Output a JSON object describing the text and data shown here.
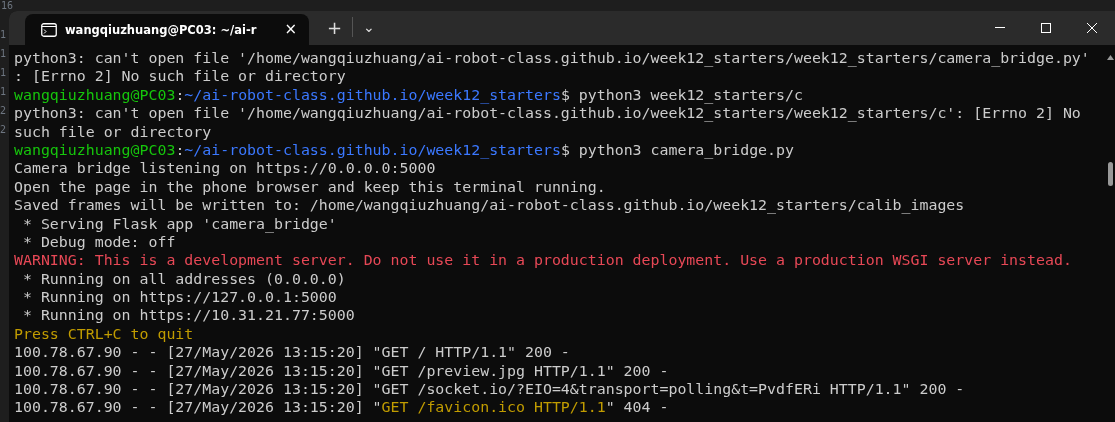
{
  "editor_gutter": {
    "line_numbers": [
      "16",
      "1",
      "1",
      "1",
      "1",
      "2",
      "2"
    ]
  },
  "window": {
    "tab": {
      "title": "wangqiuzhuang@PC03: ~/ai-r",
      "selected": true,
      "close": "×"
    },
    "new_tab": "+",
    "dropdown": "⌄"
  },
  "terminal": {
    "lines": [
      {
        "segments": [
          {
            "text": "python3: can't open file '/home/wangqiuzhuang/ai-robot-class.github.io/week12_starters/week12_starters/camera_bridge.py'",
            "color": "#cccccc"
          }
        ]
      },
      {
        "segments": [
          {
            "text": ": [Errno 2] No such file or directory",
            "color": "#cccccc"
          }
        ]
      },
      {
        "segments": [
          {
            "text": "wangqiuzhuang@PC03",
            "color": "#16c60c"
          },
          {
            "text": ":",
            "color": "#cccccc"
          },
          {
            "text": "~/ai-robot-class.github.io/week12_starters",
            "color": "#3b78ff"
          },
          {
            "text": "$ python3 week12_starters/c",
            "color": "#cccccc"
          }
        ]
      },
      {
        "segments": [
          {
            "text": "python3: can't open file '/home/wangqiuzhuang/ai-robot-class.github.io/week12_starters/week12_starters/c': [Errno 2] No",
            "color": "#cccccc"
          }
        ]
      },
      {
        "segments": [
          {
            "text": "such file or directory",
            "color": "#cccccc"
          }
        ]
      },
      {
        "segments": [
          {
            "text": "wangqiuzhuang@PC03",
            "color": "#16c60c"
          },
          {
            "text": ":",
            "color": "#cccccc"
          },
          {
            "text": "~/ai-robot-class.github.io/week12_starters",
            "color": "#3b78ff"
          },
          {
            "text": "$ python3 camera_bridge.py",
            "color": "#cccccc"
          }
        ]
      },
      {
        "segments": [
          {
            "text": "Camera bridge listening on https://0.0.0.0:5000",
            "color": "#cccccc"
          }
        ]
      },
      {
        "segments": [
          {
            "text": "Open the page in the phone browser and keep this terminal running.",
            "color": "#cccccc"
          }
        ]
      },
      {
        "segments": [
          {
            "text": "Saved frames will be written to: /home/wangqiuzhuang/ai-robot-class.github.io/week12_starters/calib_images",
            "color": "#cccccc"
          }
        ]
      },
      {
        "segments": [
          {
            "text": " * Serving Flask app 'camera_bridge'",
            "color": "#cccccc"
          }
        ]
      },
      {
        "segments": [
          {
            "text": " * Debug mode: off",
            "color": "#cccccc"
          }
        ]
      },
      {
        "segments": [
          {
            "text": "WARNING: This is a development server. Do not use it in a production deployment. Use a production WSGI server instead.",
            "color": "#e74856"
          }
        ]
      },
      {
        "segments": [
          {
            "text": " * Running on all addresses (0.0.0.0)",
            "color": "#cccccc"
          }
        ]
      },
      {
        "segments": [
          {
            "text": " * Running on https://127.0.0.1:5000",
            "color": "#cccccc"
          }
        ]
      },
      {
        "segments": [
          {
            "text": " * Running on https://10.31.21.77:5000",
            "color": "#cccccc"
          }
        ]
      },
      {
        "segments": [
          {
            "text": "Press CTRL+C to quit",
            "color": "#c19c00"
          }
        ]
      },
      {
        "segments": [
          {
            "text": "100.78.67.90 - - [27/May/2026 13:15:20] \"GET / HTTP/1.1\" 200 -",
            "color": "#cccccc"
          }
        ]
      },
      {
        "segments": [
          {
            "text": "100.78.67.90 - - [27/May/2026 13:15:20] \"GET /preview.jpg HTTP/1.1\" 200 -",
            "color": "#cccccc"
          }
        ]
      },
      {
        "segments": [
          {
            "text": "100.78.67.90 - - [27/May/2026 13:15:20] \"GET /socket.io/?EIO=4&transport=polling&t=PvdfERi HTTP/1.1\" 200 -",
            "color": "#cccccc"
          }
        ]
      },
      {
        "segments": [
          {
            "text": "100.78.67.90 - - [27/May/2026 13:15:20] \"",
            "color": "#cccccc"
          },
          {
            "text": "GET /favicon.ico HTTP/1.1",
            "color": "#c19c00"
          },
          {
            "text": "\" 404 -",
            "color": "#cccccc"
          }
        ]
      }
    ]
  }
}
